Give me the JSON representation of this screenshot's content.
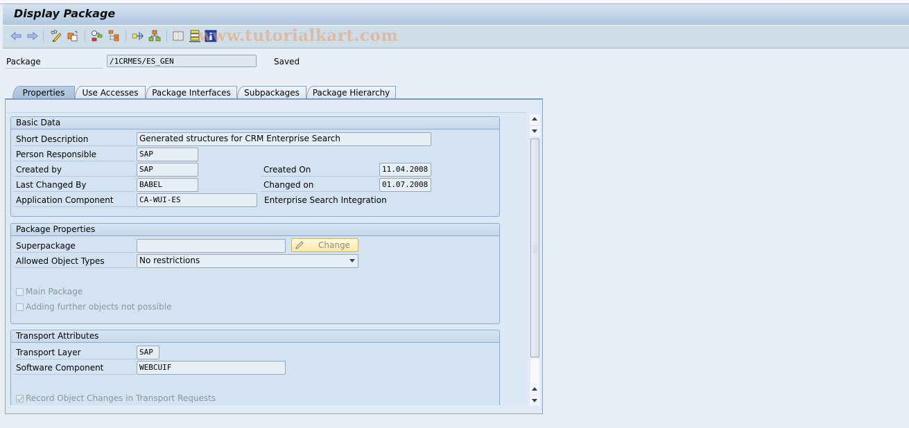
{
  "window": {
    "title": "Display Package",
    "watermark": "www.tutorialkart.com"
  },
  "toolbar": {
    "icons": [
      {
        "name": "back-arrow-icon",
        "label": "Back"
      },
      {
        "name": "forward-arrow-icon",
        "label": "Forward"
      },
      {
        "name": "display-change-icon",
        "label": "Display <-> Change"
      },
      {
        "name": "other-object-icon",
        "label": "Other Object"
      },
      {
        "name": "activate-icon",
        "label": "Check"
      },
      {
        "name": "object-list-icon",
        "label": "Object List"
      },
      {
        "name": "where-used-icon",
        "label": "Where-Used List"
      },
      {
        "name": "hierarchy-icon",
        "label": "Hierarchy"
      },
      {
        "name": "documentation-icon",
        "label": "Documentation"
      },
      {
        "name": "transport-icon",
        "label": "Transport"
      },
      {
        "name": "info-icon",
        "label": "Information"
      }
    ]
  },
  "header": {
    "package_label": "Package",
    "package_value": "/1CRMES/ES_GEN",
    "status": "Saved"
  },
  "tabs": [
    {
      "label": "Properties",
      "active": true
    },
    {
      "label": "Use Accesses",
      "active": false
    },
    {
      "label": "Package Interfaces",
      "active": false
    },
    {
      "label": "Subpackages",
      "active": false
    },
    {
      "label": "Package Hierarchy",
      "active": false
    }
  ],
  "basic_data": {
    "title": "Basic Data",
    "short_description_label": "Short Description",
    "short_description_value": "Generated structures for CRM Enterprise Search",
    "person_responsible_label": "Person Responsible",
    "person_responsible_value": "SAP",
    "created_by_label": "Created by",
    "created_by_value": "SAP",
    "created_on_label": "Created On",
    "created_on_value": "11.04.2008",
    "last_changed_by_label": "Last Changed By",
    "last_changed_by_value": "BABEL",
    "changed_on_label": "Changed on",
    "changed_on_value": "01.07.2008",
    "app_component_label": "Application Component",
    "app_component_value": "CA-WUI-ES",
    "app_component_text": "Enterprise Search Integration"
  },
  "package_properties": {
    "title": "Package Properties",
    "superpackage_label": "Superpackage",
    "superpackage_value": "",
    "change_button": "Change",
    "allowed_types_label": "Allowed Object Types",
    "allowed_types_value": "No restrictions",
    "main_package_label": "Main Package",
    "main_package_checked": false,
    "no_further_objects_label": "Adding further objects not possible",
    "no_further_objects_checked": false
  },
  "transport_attributes": {
    "title": "Transport Attributes",
    "transport_layer_label": "Transport Layer",
    "transport_layer_value": "SAP",
    "software_component_label": "Software Component",
    "software_component_value": "WEBCUIF",
    "record_changes_label": "Record Object Changes in Transport Requests",
    "record_changes_checked": true
  }
}
